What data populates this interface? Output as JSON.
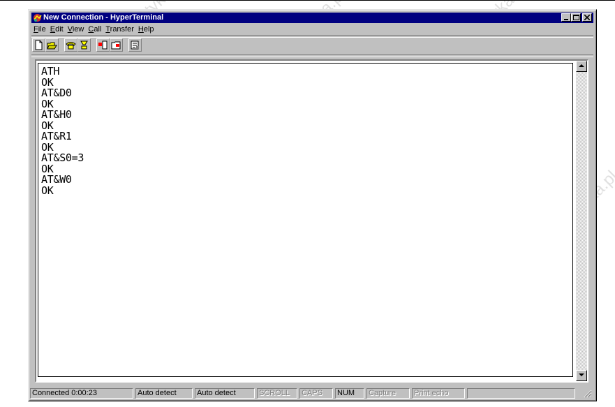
{
  "window": {
    "title": "New Connection - HyperTerminal"
  },
  "menu": [
    {
      "pre": "",
      "u": "F",
      "post": "ile"
    },
    {
      "pre": "",
      "u": "E",
      "post": "dit"
    },
    {
      "pre": "",
      "u": "V",
      "post": "iew"
    },
    {
      "pre": "",
      "u": "C",
      "post": "all"
    },
    {
      "pre": "",
      "u": "T",
      "post": "ransfer"
    },
    {
      "pre": "",
      "u": "H",
      "post": "elp"
    }
  ],
  "toolbar": {
    "buttons": [
      "new-file-icon",
      "open-folder-icon",
      "connect-phone-icon",
      "disconnect-phone-icon",
      "send-file-icon",
      "receive-file-icon",
      "properties-icon"
    ]
  },
  "terminal": {
    "lines": [
      "ATH",
      "OK",
      "AT&D0",
      "OK",
      "AT&H0",
      "OK",
      "AT&R1",
      "OK",
      "AT&S0=3",
      "OK",
      "AT&W0",
      "OK"
    ]
  },
  "status": {
    "connected": "Connected 0:00:23",
    "detect1": "Auto detect",
    "detect2": "Auto detect",
    "scroll": "SCROLL",
    "caps": "CAPS",
    "num": "NUM",
    "capture": "Capture",
    "print_echo": "Print echo"
  },
  "watermark": "www.rgbautomatyka.pl",
  "colors": {
    "titlebar": "#000080",
    "face": "#c0c0c0"
  }
}
